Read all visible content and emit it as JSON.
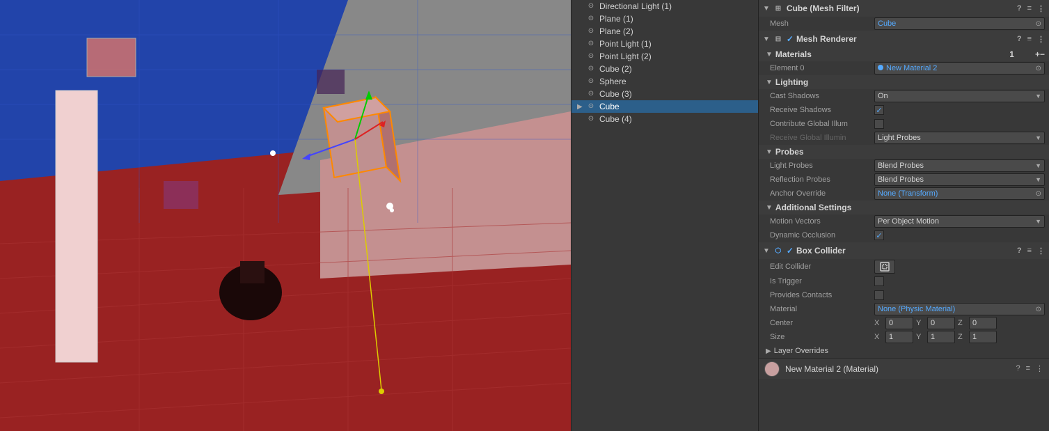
{
  "viewport": {
    "label": "Scene Viewport"
  },
  "hierarchy": {
    "items": [
      {
        "id": "directional-light-1",
        "label": "Directional Light (1)",
        "icon": "💡",
        "indent": 0,
        "selected": false,
        "hasArrow": false
      },
      {
        "id": "plane-1",
        "label": "Plane (1)",
        "icon": "◻",
        "indent": 0,
        "selected": false,
        "hasArrow": false
      },
      {
        "id": "plane-2",
        "label": "Plane (2)",
        "icon": "◻",
        "indent": 0,
        "selected": false,
        "hasArrow": false
      },
      {
        "id": "point-light-1",
        "label": "Point Light (1)",
        "icon": "💡",
        "indent": 0,
        "selected": false,
        "hasArrow": false
      },
      {
        "id": "point-light-2",
        "label": "Point Light (2)",
        "icon": "💡",
        "indent": 0,
        "selected": false,
        "hasArrow": false
      },
      {
        "id": "cube-2",
        "label": "Cube (2)",
        "icon": "◻",
        "indent": 0,
        "selected": false,
        "hasArrow": false
      },
      {
        "id": "sphere",
        "label": "Sphere",
        "icon": "○",
        "indent": 0,
        "selected": false,
        "hasArrow": false
      },
      {
        "id": "cube-3",
        "label": "Cube (3)",
        "icon": "◻",
        "indent": 0,
        "selected": false,
        "hasArrow": false
      },
      {
        "id": "cube",
        "label": "Cube",
        "icon": "◻",
        "indent": 0,
        "selected": true,
        "hasArrow": true
      },
      {
        "id": "cube-4",
        "label": "Cube (4)",
        "icon": "◻",
        "indent": 0,
        "selected": false,
        "hasArrow": false
      }
    ]
  },
  "inspector": {
    "meshFilter": {
      "title": "Cube (Mesh Filter)",
      "meshLabel": "Mesh",
      "meshValue": "Cube"
    },
    "meshRenderer": {
      "title": "Mesh Renderer",
      "sections": {
        "materials": {
          "label": "Materials",
          "count": "1",
          "element0Label": "Element 0",
          "element0Value": "New Material 2"
        },
        "lighting": {
          "label": "Lighting",
          "castShadowsLabel": "Cast Shadows",
          "castShadowsValue": "On",
          "receiveShadowsLabel": "Receive Shadows",
          "receiveShadowsChecked": true,
          "contributeGILabel": "Contribute Global Illum",
          "receiveGILabel": "Receive Global Illumin",
          "receiveGIValue": "Light Probes"
        },
        "probes": {
          "label": "Probes",
          "lightProbesLabel": "Light Probes",
          "lightProbesValue": "Blend Probes",
          "reflectionProbesLabel": "Reflection Probes",
          "reflectionProbesValue": "Blend Probes",
          "anchorOverrideLabel": "Anchor Override",
          "anchorOverrideValue": "None (Transform)"
        },
        "additionalSettings": {
          "label": "Additional Settings",
          "motionVectorsLabel": "Motion Vectors",
          "motionVectorsValue": "Per Object Motion",
          "dynamicOcclusionLabel": "Dynamic Occlusion",
          "dynamicOcclusionChecked": true
        }
      }
    },
    "boxCollider": {
      "title": "Box Collider",
      "editColliderLabel": "Edit Collider",
      "isTriggerLabel": "Is Trigger",
      "isTriggerChecked": false,
      "providesContactsLabel": "Provides Contacts",
      "providesContactsChecked": false,
      "materialLabel": "Material",
      "materialValue": "None (Physic Material)",
      "centerLabel": "Center",
      "centerX": "0",
      "centerY": "0",
      "centerZ": "0",
      "sizeLabel": "Size",
      "sizeX": "1",
      "sizeY": "1",
      "sizeZ": "1"
    },
    "layerOverrides": {
      "label": "Layer Overrides"
    },
    "materialFooter": {
      "label": "New Material 2 (Material)"
    }
  }
}
